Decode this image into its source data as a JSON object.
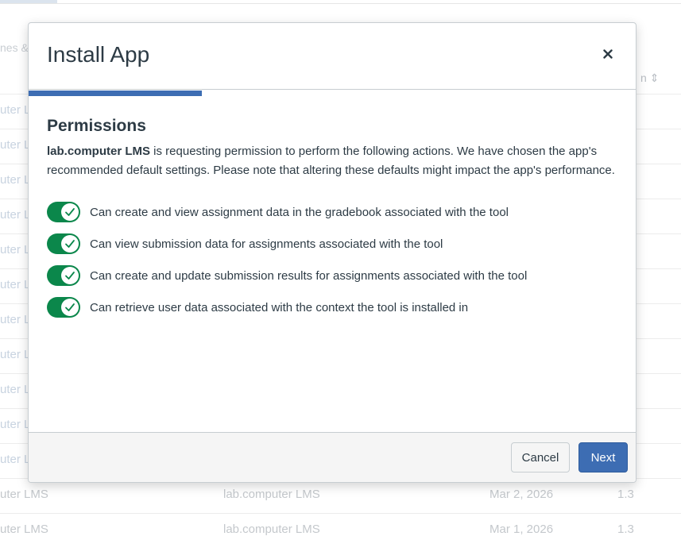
{
  "background": {
    "header_fragment": "nes &",
    "column_fragment": "n ⇕",
    "left_fragment": "uter L",
    "rows": [
      {
        "name": "uter LMS",
        "developer": "lab.computer LMS",
        "date": "Mar 2, 2026",
        "version": "1.3"
      },
      {
        "name": "uter LMS",
        "developer": "lab.computer LMS",
        "date": "Mar 1, 2026",
        "version": "1.3"
      }
    ]
  },
  "modal": {
    "title": "Install App",
    "close_label": "×",
    "progress": 0.285,
    "heading": "Permissions",
    "app_name": "lab.computer LMS",
    "description_rest": " is requesting permission to perform the following actions. We have chosen the app's recommended default settings. Please note that altering these defaults might impact the app's performance.",
    "permissions": [
      {
        "label": "Can create and view assignment data in the gradebook associated with the tool",
        "enabled": true
      },
      {
        "label": "Can view submission data for assignments associated with the tool",
        "enabled": true
      },
      {
        "label": "Can create and update submission results for assignments associated with the tool",
        "enabled": true
      },
      {
        "label": "Can retrieve user data associated with the context the tool is installed in",
        "enabled": true
      }
    ],
    "footer": {
      "cancel_label": "Cancel",
      "next_label": "Next"
    }
  },
  "colors": {
    "accent": "#3d6db3",
    "toggle_on": "#0b874b",
    "text": "#2d3b45"
  },
  "icons": {
    "close": "close-icon",
    "check": "check-icon"
  }
}
